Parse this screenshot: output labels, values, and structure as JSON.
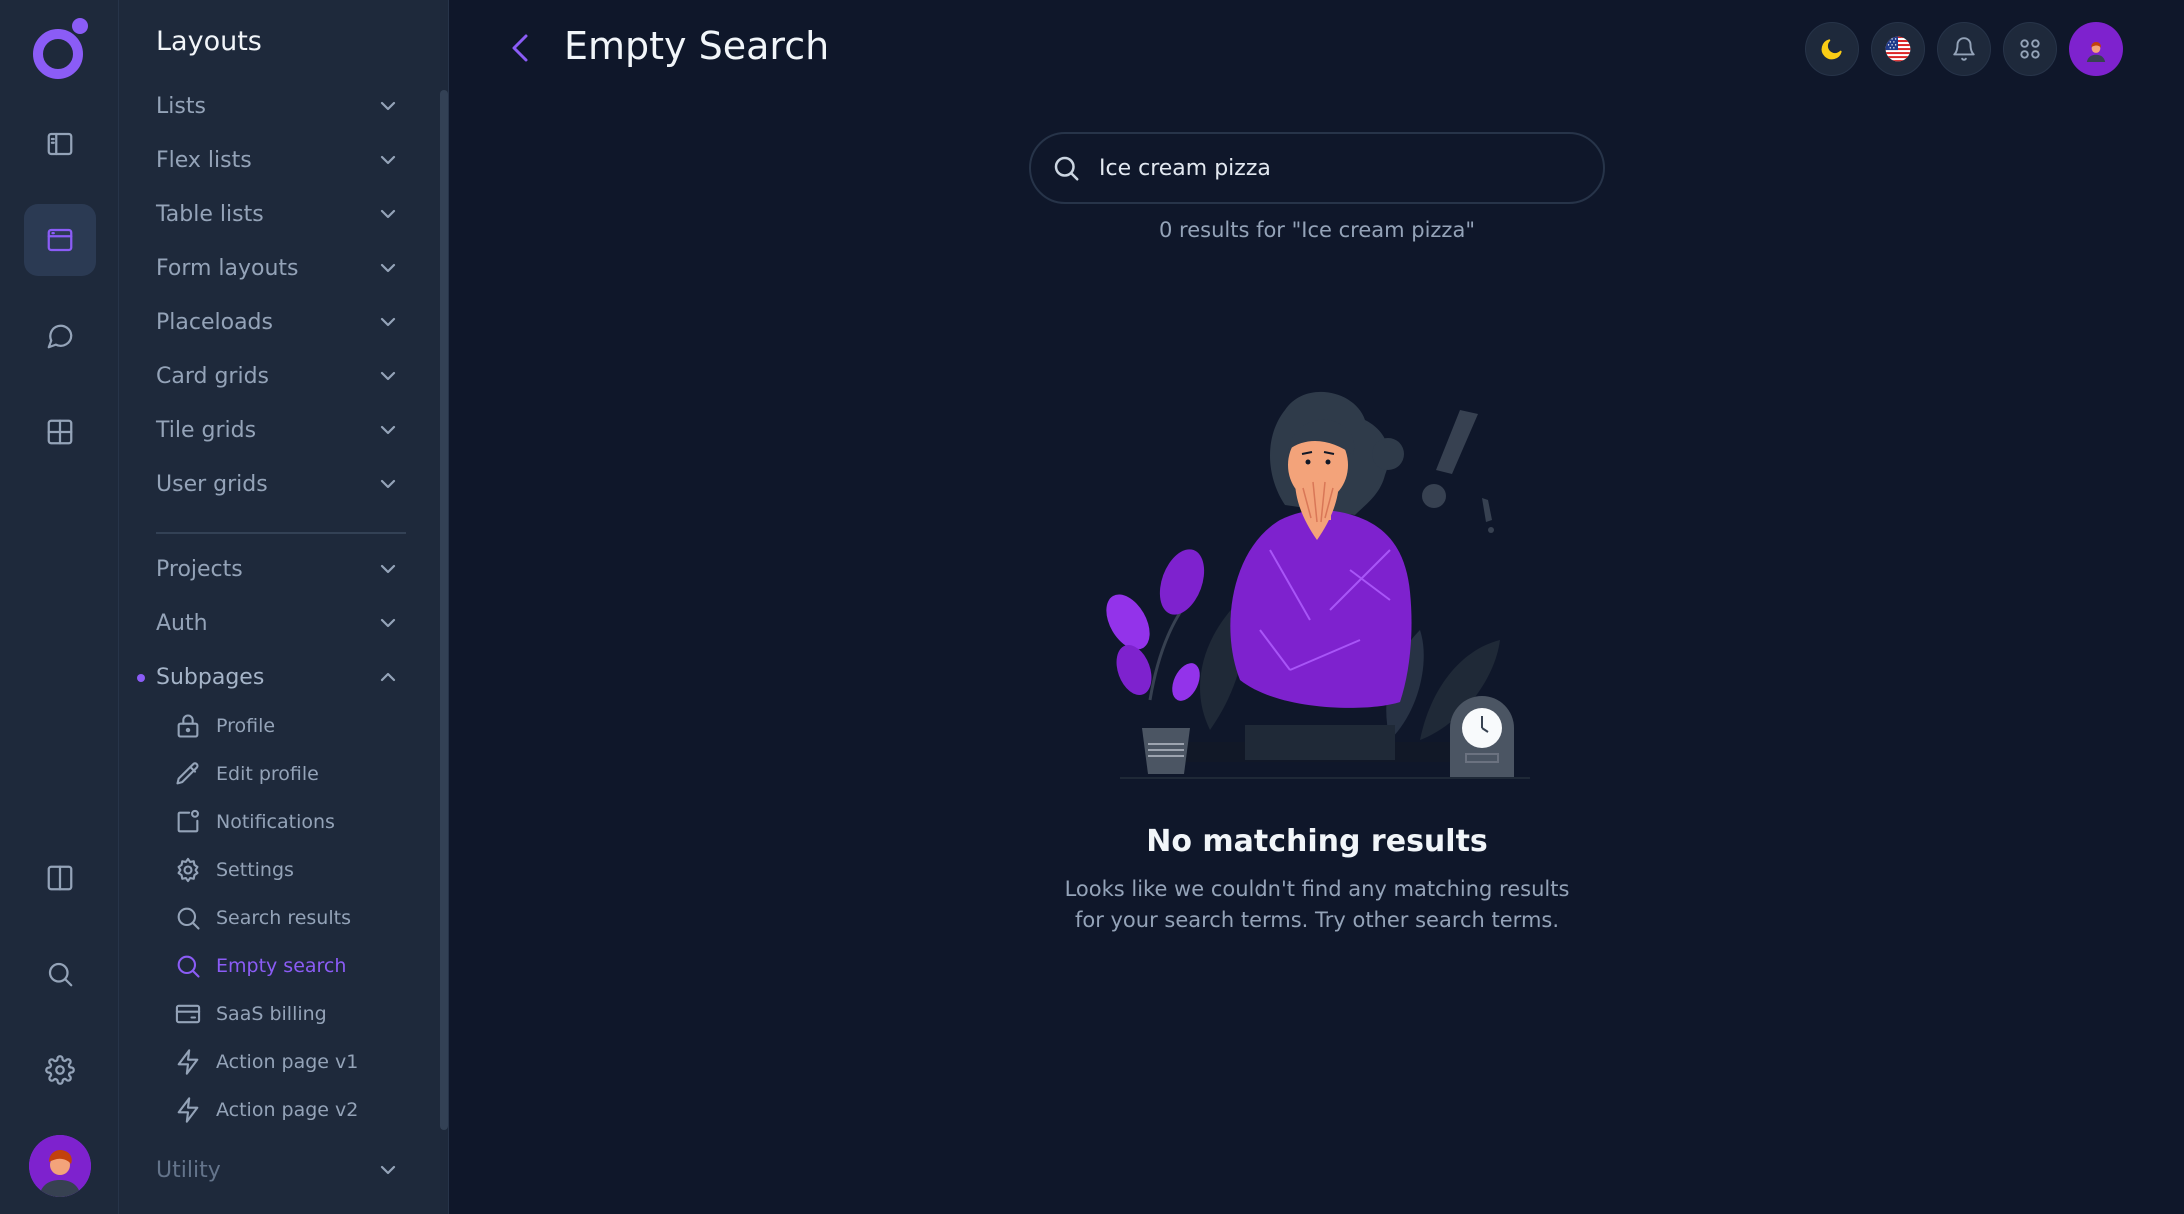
{
  "sidebar": {
    "title": "Layouts",
    "groups": [
      {
        "label": "Lists"
      },
      {
        "label": "Flex lists"
      },
      {
        "label": "Table lists"
      },
      {
        "label": "Form layouts"
      },
      {
        "label": "Placeloads"
      },
      {
        "label": "Card grids"
      },
      {
        "label": "Tile grids"
      },
      {
        "label": "User grids"
      }
    ],
    "groups2": [
      {
        "label": "Projects"
      },
      {
        "label": "Auth"
      },
      {
        "label": "Subpages"
      }
    ],
    "subpages": [
      {
        "label": "Profile",
        "icon": "lock-icon"
      },
      {
        "label": "Edit profile",
        "icon": "pencil-icon"
      },
      {
        "label": "Notifications",
        "icon": "notification-icon"
      },
      {
        "label": "Settings",
        "icon": "gear-icon"
      },
      {
        "label": "Search results",
        "icon": "search-icon"
      },
      {
        "label": "Empty search",
        "icon": "search-icon",
        "active": true
      },
      {
        "label": "SaaS billing",
        "icon": "credit-card-icon"
      },
      {
        "label": "Action page v1",
        "icon": "lightning-icon"
      },
      {
        "label": "Action page v2",
        "icon": "lightning-icon"
      }
    ],
    "utility": "Utility"
  },
  "header": {
    "title": "Empty Search"
  },
  "search": {
    "value": "Ice cream pizza",
    "result_text": "0 results for \"Ice cream pizza\""
  },
  "empty_state": {
    "title": "No matching results",
    "line1": "Looks like we couldn't find any matching results",
    "line2": "for your search terms. Try other search terms."
  },
  "colors": {
    "background": "#0f172a",
    "panel": "#1e293b",
    "accent": "#8b5cf6"
  }
}
